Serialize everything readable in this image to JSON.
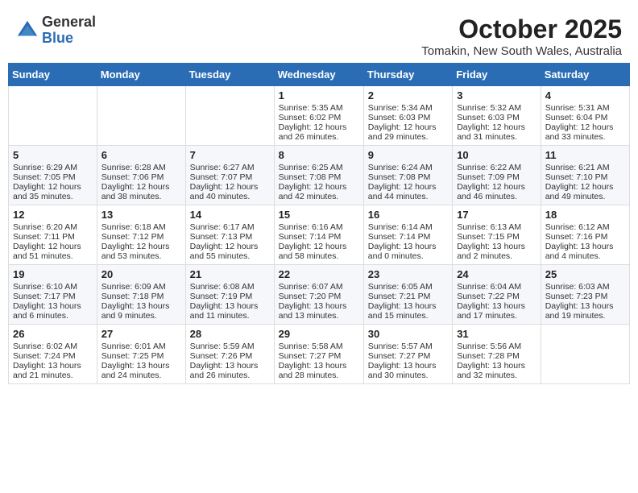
{
  "header": {
    "logo_general": "General",
    "logo_blue": "Blue",
    "title": "October 2025",
    "subtitle": "Tomakin, New South Wales, Australia"
  },
  "weekdays": [
    "Sunday",
    "Monday",
    "Tuesday",
    "Wednesday",
    "Thursday",
    "Friday",
    "Saturday"
  ],
  "weeks": [
    [
      {
        "day": "",
        "text": ""
      },
      {
        "day": "",
        "text": ""
      },
      {
        "day": "",
        "text": ""
      },
      {
        "day": "1",
        "text": "Sunrise: 5:35 AM\nSunset: 6:02 PM\nDaylight: 12 hours\nand 26 minutes."
      },
      {
        "day": "2",
        "text": "Sunrise: 5:34 AM\nSunset: 6:03 PM\nDaylight: 12 hours\nand 29 minutes."
      },
      {
        "day": "3",
        "text": "Sunrise: 5:32 AM\nSunset: 6:03 PM\nDaylight: 12 hours\nand 31 minutes."
      },
      {
        "day": "4",
        "text": "Sunrise: 5:31 AM\nSunset: 6:04 PM\nDaylight: 12 hours\nand 33 minutes."
      }
    ],
    [
      {
        "day": "5",
        "text": "Sunrise: 6:29 AM\nSunset: 7:05 PM\nDaylight: 12 hours\nand 35 minutes."
      },
      {
        "day": "6",
        "text": "Sunrise: 6:28 AM\nSunset: 7:06 PM\nDaylight: 12 hours\nand 38 minutes."
      },
      {
        "day": "7",
        "text": "Sunrise: 6:27 AM\nSunset: 7:07 PM\nDaylight: 12 hours\nand 40 minutes."
      },
      {
        "day": "8",
        "text": "Sunrise: 6:25 AM\nSunset: 7:08 PM\nDaylight: 12 hours\nand 42 minutes."
      },
      {
        "day": "9",
        "text": "Sunrise: 6:24 AM\nSunset: 7:08 PM\nDaylight: 12 hours\nand 44 minutes."
      },
      {
        "day": "10",
        "text": "Sunrise: 6:22 AM\nSunset: 7:09 PM\nDaylight: 12 hours\nand 46 minutes."
      },
      {
        "day": "11",
        "text": "Sunrise: 6:21 AM\nSunset: 7:10 PM\nDaylight: 12 hours\nand 49 minutes."
      }
    ],
    [
      {
        "day": "12",
        "text": "Sunrise: 6:20 AM\nSunset: 7:11 PM\nDaylight: 12 hours\nand 51 minutes."
      },
      {
        "day": "13",
        "text": "Sunrise: 6:18 AM\nSunset: 7:12 PM\nDaylight: 12 hours\nand 53 minutes."
      },
      {
        "day": "14",
        "text": "Sunrise: 6:17 AM\nSunset: 7:13 PM\nDaylight: 12 hours\nand 55 minutes."
      },
      {
        "day": "15",
        "text": "Sunrise: 6:16 AM\nSunset: 7:14 PM\nDaylight: 12 hours\nand 58 minutes."
      },
      {
        "day": "16",
        "text": "Sunrise: 6:14 AM\nSunset: 7:14 PM\nDaylight: 13 hours\nand 0 minutes."
      },
      {
        "day": "17",
        "text": "Sunrise: 6:13 AM\nSunset: 7:15 PM\nDaylight: 13 hours\nand 2 minutes."
      },
      {
        "day": "18",
        "text": "Sunrise: 6:12 AM\nSunset: 7:16 PM\nDaylight: 13 hours\nand 4 minutes."
      }
    ],
    [
      {
        "day": "19",
        "text": "Sunrise: 6:10 AM\nSunset: 7:17 PM\nDaylight: 13 hours\nand 6 minutes."
      },
      {
        "day": "20",
        "text": "Sunrise: 6:09 AM\nSunset: 7:18 PM\nDaylight: 13 hours\nand 9 minutes."
      },
      {
        "day": "21",
        "text": "Sunrise: 6:08 AM\nSunset: 7:19 PM\nDaylight: 13 hours\nand 11 minutes."
      },
      {
        "day": "22",
        "text": "Sunrise: 6:07 AM\nSunset: 7:20 PM\nDaylight: 13 hours\nand 13 minutes."
      },
      {
        "day": "23",
        "text": "Sunrise: 6:05 AM\nSunset: 7:21 PM\nDaylight: 13 hours\nand 15 minutes."
      },
      {
        "day": "24",
        "text": "Sunrise: 6:04 AM\nSunset: 7:22 PM\nDaylight: 13 hours\nand 17 minutes."
      },
      {
        "day": "25",
        "text": "Sunrise: 6:03 AM\nSunset: 7:23 PM\nDaylight: 13 hours\nand 19 minutes."
      }
    ],
    [
      {
        "day": "26",
        "text": "Sunrise: 6:02 AM\nSunset: 7:24 PM\nDaylight: 13 hours\nand 21 minutes."
      },
      {
        "day": "27",
        "text": "Sunrise: 6:01 AM\nSunset: 7:25 PM\nDaylight: 13 hours\nand 24 minutes."
      },
      {
        "day": "28",
        "text": "Sunrise: 5:59 AM\nSunset: 7:26 PM\nDaylight: 13 hours\nand 26 minutes."
      },
      {
        "day": "29",
        "text": "Sunrise: 5:58 AM\nSunset: 7:27 PM\nDaylight: 13 hours\nand 28 minutes."
      },
      {
        "day": "30",
        "text": "Sunrise: 5:57 AM\nSunset: 7:27 PM\nDaylight: 13 hours\nand 30 minutes."
      },
      {
        "day": "31",
        "text": "Sunrise: 5:56 AM\nSunset: 7:28 PM\nDaylight: 13 hours\nand 32 minutes."
      },
      {
        "day": "",
        "text": ""
      }
    ]
  ]
}
